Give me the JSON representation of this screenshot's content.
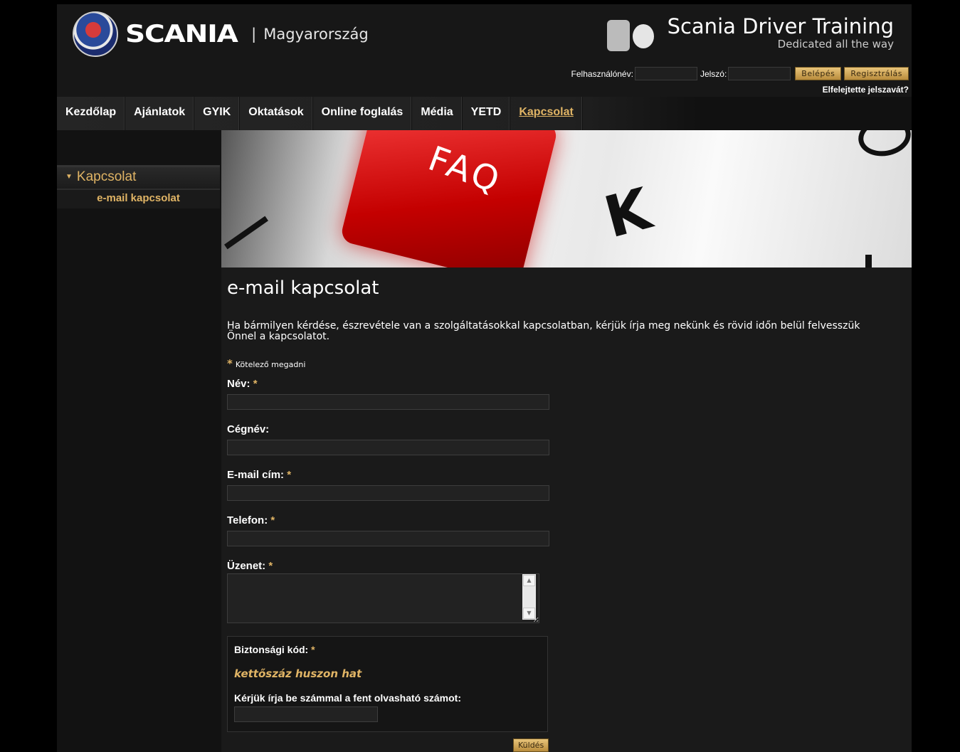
{
  "header": {
    "brand": "SCANIA",
    "separator": "|",
    "region": "Magyarország",
    "title": "Scania Driver Training",
    "tagline": "Dedicated all the way",
    "login": {
      "username_label": "Felhasználónév:",
      "username_value": "",
      "password_label": "Jelszó:",
      "password_value": "",
      "login_button": "Belépés",
      "register_button": "Regisztrálás",
      "forgot_link": "Elfelejtette jelszavát?"
    }
  },
  "nav": {
    "items": [
      "Kezdőlap",
      "Ajánlatok",
      "GYIK",
      "Oktatások",
      "Online foglalás",
      "Média",
      "YETD",
      "Kapcsolat"
    ],
    "active": "Kapcsolat"
  },
  "sidebar": {
    "section": "Kapcsolat",
    "subitem": "e-mail kapcsolat"
  },
  "banner": {
    "key_text": "FAQ",
    "letter_k": "K"
  },
  "main": {
    "title": "e-mail kapcsolat",
    "intro": "Ha bármilyen kérdése, észrevétele van a szolgáltatásokkal kapcsolatban, kérjük írja meg nekünk és rövid időn belül felvesszük Önnel a kapcsolatot.",
    "required_marker": "*",
    "required_note": "Kötelező megadni",
    "fields": {
      "name": "Név:",
      "company": "Cégnév:",
      "email": "E-mail cím:",
      "phone": "Telefon:",
      "message": "Üzenet:"
    },
    "captcha": {
      "label": "Biztonsági kód:",
      "code_text": "kettőszáz huszon hat",
      "hint": "Kérjük írja be számmal a fent olvasható számot:",
      "value": ""
    },
    "submit": "Küldés"
  },
  "colors": {
    "accent_gold": "#e0b465",
    "background": "#121212"
  }
}
